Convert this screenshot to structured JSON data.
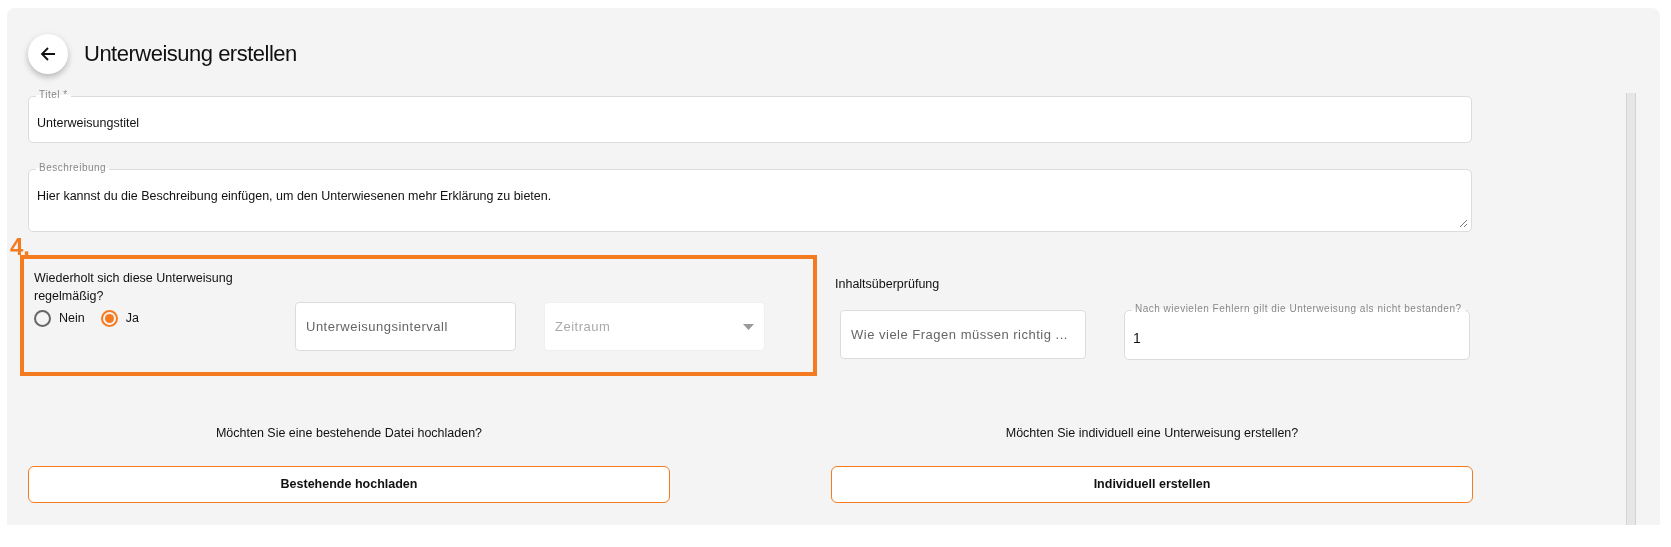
{
  "header": {
    "title": "Unterweisung erstellen"
  },
  "title_field": {
    "label": "Titel *",
    "value": "Unterweisungstitel"
  },
  "description_field": {
    "label": "Beschreibung",
    "value": "Hier kannst du die Beschreibung einfügen, um den Unterwiesenen mehr Erklärung zu bieten."
  },
  "step_marker": "4.",
  "recurrence": {
    "question": "Wiederholt sich diese Unterweisung regelmäßig?",
    "options": [
      {
        "label": "Nein",
        "selected": false
      },
      {
        "label": "Ja",
        "selected": true
      }
    ],
    "interval_field": {
      "placeholder": "Unterweisungsintervall",
      "disabled": false
    },
    "period_select": {
      "placeholder": "Zeitraum",
      "disabled": true
    }
  },
  "content_check": {
    "heading": "Inhaltsüberprüfung",
    "required_correct_field": {
      "placeholder": "Wie viele Fragen müssen richtig ..."
    },
    "max_errors_field": {
      "label": "Nach wievielen Fehlern gilt die Unterweisung als nicht bestanden?",
      "value": "1"
    }
  },
  "actions": [
    {
      "question": "Möchten Sie eine bestehende Datei hochladen?",
      "button": "Bestehende hochladen"
    },
    {
      "question": "Möchten Sie individuell eine Unterweisung erstellen?",
      "button": "Individuell erstellen"
    }
  ]
}
